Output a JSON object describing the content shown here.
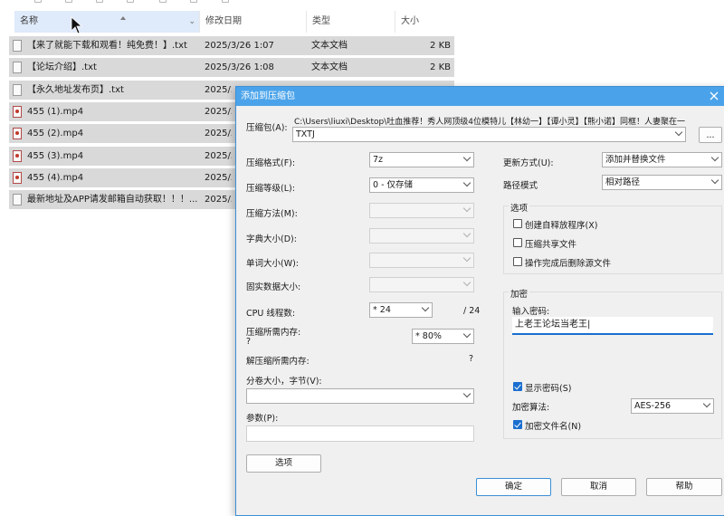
{
  "explorer": {
    "columns": {
      "name": "名称",
      "date": "修改日期",
      "type": "类型",
      "size": "大小"
    },
    "files": [
      {
        "name": "【来了就能下载和观看！纯免费！】.txt",
        "date": "2025/3/26 1:07",
        "type": "文本文档",
        "size": "2 KB",
        "icon": "text-file-icon"
      },
      {
        "name": "【论坛介绍】.txt",
        "date": "2025/3/26 1:08",
        "type": "文本文档",
        "size": "2 KB",
        "icon": "text-file-icon"
      },
      {
        "name": "【永久地址发布页】.txt",
        "date": "2025/3",
        "type": "",
        "size": "",
        "icon": "text-file-icon"
      },
      {
        "name": "455 (1).mp4",
        "date": "2025/5",
        "type": "",
        "size": "",
        "icon": "video-file-icon"
      },
      {
        "name": "455 (2).mp4",
        "date": "2025/5",
        "type": "",
        "size": "",
        "icon": "video-file-icon"
      },
      {
        "name": "455 (3).mp4",
        "date": "2025/5",
        "type": "",
        "size": "",
        "icon": "video-file-icon"
      },
      {
        "name": "455 (4).mp4",
        "date": "2025/5",
        "type": "",
        "size": "",
        "icon": "video-file-icon"
      },
      {
        "name": "最新地址及APP请发邮箱自动获取！！！...",
        "date": "2025/5",
        "type": "",
        "size": "",
        "icon": "text-file-icon"
      }
    ]
  },
  "dialog": {
    "title": "添加到压缩包",
    "archive_label": "压缩包(A):",
    "archive_path": "C:\\Users\\liuxi\\Desktop\\吐血推荐！秀人网顶级4位模特儿【林幼一】【谭小灵】【熊小诺】同框！人妻聚在一",
    "archive_name": "TXTJ",
    "browse_label": "...",
    "format_label": "压缩格式(F):",
    "format_value": "7z",
    "level_label": "压缩等级(L):",
    "level_value": "0 - 仅存储",
    "method_label": "压缩方法(M):",
    "dict_label": "字典大小(D):",
    "word_label": "单词大小(W):",
    "solid_label": "固实数据大小:",
    "threads_label": "CPU 线程数:",
    "threads_value": "* 24",
    "threads_max": "/ 24",
    "mem_label": "压缩所需内存:",
    "mem_q": "?",
    "mem_value": "* 80%",
    "decomp_label": "解压缩所需内存:",
    "decomp_q": "?",
    "split_label": "分卷大小，字节(V):",
    "params_label": "参数(P):",
    "options_button": "选项",
    "update_label": "更新方式(U):",
    "update_value": "添加并替换文件",
    "path_label": "路径模式",
    "path_value": "相对路径",
    "options_group": "选项",
    "opt_sfx": "创建自释放程序(X)",
    "opt_shared": "压缩共享文件",
    "opt_delete": "操作完成后删除源文件",
    "encrypt_group": "加密",
    "pw_label": "输入密码:",
    "pw_value": "上老王论坛当老王|",
    "show_pw": "显示密码(S)",
    "enc_method_label": "加密算法:",
    "enc_method_value": "AES-256",
    "enc_names": "加密文件名(N)",
    "ok": "确定",
    "cancel": "取消",
    "help": "帮助"
  }
}
